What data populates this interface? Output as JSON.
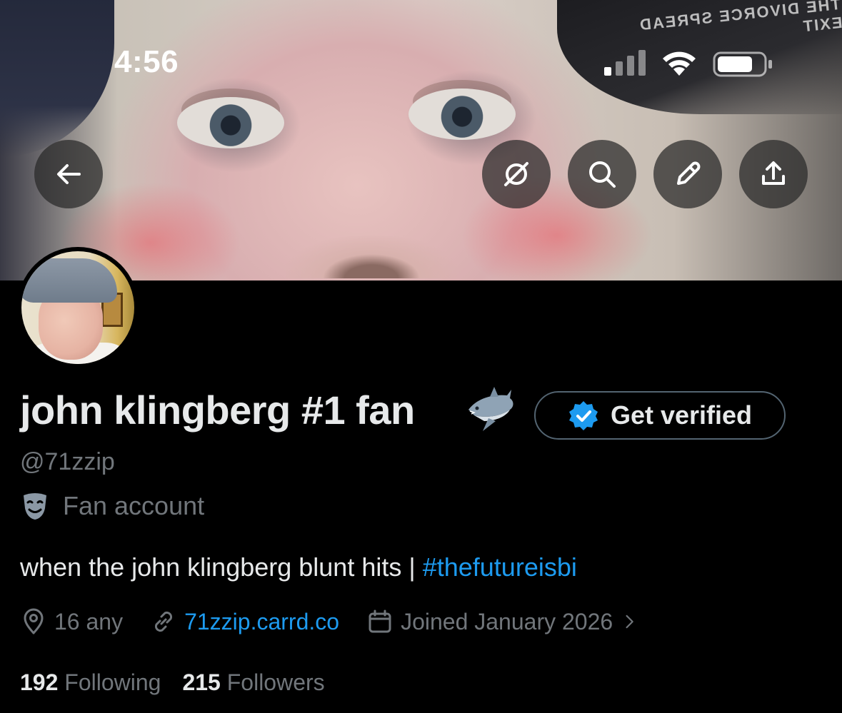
{
  "status_bar": {
    "time": "4:56"
  },
  "banner": {
    "watermark_text": "THE DIVORCE SPREAD EXIT"
  },
  "header_buttons": {
    "back_icon": "arrow-left-icon",
    "grok_icon": "grok-icon",
    "search_icon": "search-icon",
    "edit_icon": "pencil-icon",
    "share_icon": "share-icon"
  },
  "profile": {
    "display_name": "john klingberg #1 fan",
    "name_emoji": "🦈",
    "get_verified_label": "Get verified",
    "handle": "@71zzip",
    "category_label": "Fan account",
    "bio_text": "when the john klingberg blunt hits | ",
    "bio_hashtag": "#thefutureisbi",
    "location": "16  any",
    "website": "71zzip.carrd.co",
    "joined": "Joined January 2026",
    "following_count": "192",
    "following_label": "Following",
    "followers_count": "215",
    "followers_label": "Followers"
  },
  "colors": {
    "background": "#000000",
    "primary_text": "#e7e9ea",
    "secondary_text": "#71767b",
    "accent_blue": "#1d9bf0",
    "verify_badge": "#1d9bf0",
    "button_border": "#536471"
  }
}
